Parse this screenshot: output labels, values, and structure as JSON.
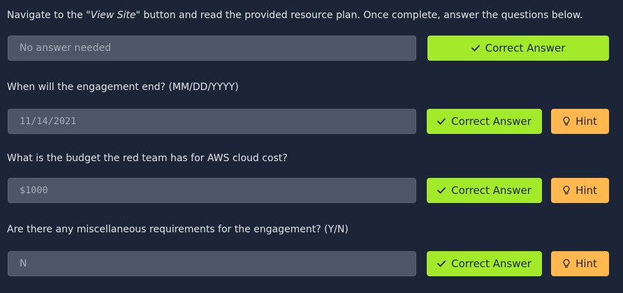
{
  "task": {
    "intro_prefix": "Navigate to the \"",
    "intro_link": "View Site\"",
    "intro_suffix": "  button and read the provided resource plan. Once complete, answer the questions below.",
    "questions": [
      {
        "answer_value": "No answer needed",
        "correct_label": "Correct Answer"
      },
      {
        "text": "When will the engagement end? (MM/DD/YYYY)",
        "answer_value": "11/14/2021",
        "correct_label": "Correct Answer",
        "hint_label": "Hint"
      },
      {
        "text": "What is the budget the red team has for AWS cloud cost?",
        "answer_value": "$1000",
        "correct_label": "Correct Answer",
        "hint_label": "Hint"
      },
      {
        "text": "Are there any miscellaneous requirements for the engagement? (Y/N)",
        "answer_value": "N",
        "correct_label": "Correct Answer",
        "hint_label": "Hint"
      }
    ]
  },
  "colors": {
    "background": "#1c2538",
    "correct": "#a3ea2a",
    "hint": "#ffb84d",
    "input": "#4d5666"
  },
  "icons": {
    "correct": "check-icon",
    "hint": "lightbulb-icon"
  }
}
